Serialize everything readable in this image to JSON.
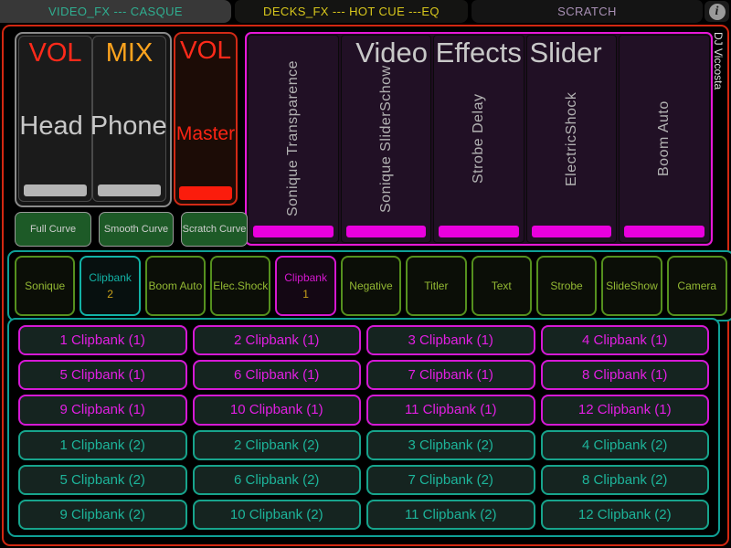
{
  "tab_bar": {
    "tabs": [
      {
        "label": "VIDEO_FX --- CASQUE",
        "active": true
      },
      {
        "label": "DECKS_FX --- HOT CUE ---EQ",
        "active": false
      },
      {
        "label": "SCRATCH",
        "active": false
      }
    ],
    "info_icon": "i"
  },
  "watermark": "DJ Viccosta",
  "mixer": {
    "headphone": {
      "vol_label": "VOL",
      "mix_label": "MIX",
      "caption": "Head Phone"
    },
    "master": {
      "vol_label": "VOL",
      "caption": "Master"
    }
  },
  "curve_buttons": [
    {
      "label": "Full Curve"
    },
    {
      "label": "Smooth Curve"
    },
    {
      "label": "Scratch Curve"
    }
  ],
  "video_effects": {
    "title": "Video Effects Slider",
    "sliders": [
      {
        "label": "Sonique Transparence"
      },
      {
        "label": "Sonique SliderSchow"
      },
      {
        "label": "Strobe Delay"
      },
      {
        "label": "ElectricShock"
      },
      {
        "label": "Boom Auto"
      }
    ]
  },
  "effect_buttons": [
    {
      "label": "Sonique",
      "style": "green"
    },
    {
      "label": "Clipbank",
      "sub": "2",
      "style": "teal"
    },
    {
      "label": "Boom Auto",
      "style": "green"
    },
    {
      "label": "Elec.Shock",
      "style": "green"
    },
    {
      "label": "Clipbank",
      "sub": "1",
      "style": "magenta"
    },
    {
      "label": "Negative",
      "style": "green"
    },
    {
      "label": "Titler",
      "style": "green"
    },
    {
      "label": "Text",
      "style": "green"
    },
    {
      "label": "Strobe",
      "style": "green"
    },
    {
      "label": "SlideShow",
      "style": "green"
    },
    {
      "label": "Camera",
      "style": "green"
    }
  ],
  "clip_grid": {
    "bank1": [
      "1 Clipbank (1)",
      "2 Clipbank (1)",
      "3 Clipbank (1)",
      "4 Clipbank (1)",
      "5 Clipbank (1)",
      "6 Clipbank (1)",
      "7 Clipbank (1)",
      "8 Clipbank (1)",
      "9 Clipbank (1)",
      "10 Clipbank (1)",
      "11 Clipbank (1)",
      "12 Clipbank (1)"
    ],
    "bank2": [
      "1 Clipbank (2)",
      "2 Clipbank (2)",
      "3 Clipbank (2)",
      "4 Clipbank (2)",
      "5 Clipbank (2)",
      "6 Clipbank (2)",
      "7 Clipbank (2)",
      "8 Clipbank (2)",
      "9 Clipbank (2)",
      "10 Clipbank (2)",
      "11 Clipbank (2)",
      "12 Clipbank (2)"
    ]
  },
  "colors": {
    "frame_red": "#d32711",
    "panel_magenta": "#e718d8",
    "container_teal": "#0fa096",
    "tab_active_text": "#2fae90",
    "tab_decks_text": "#d8c71c",
    "tab_scratch_text": "#a88fb4",
    "vol_red": "#ff2a1a",
    "mix_orange": "#ffa41e",
    "handle_gray": "#b5b5b5",
    "handle_red": "#fb1c0c",
    "handle_magenta": "#ea00de",
    "curve_green": "#1d5a27",
    "fx_green": "#93b833",
    "fx_teal": "#12b2a6",
    "fx_magenta": "#d517cf",
    "clip_magenta": "#e21fe2",
    "clip_teal": "#1db49a",
    "sub_yellow": "#c9a21a"
  }
}
